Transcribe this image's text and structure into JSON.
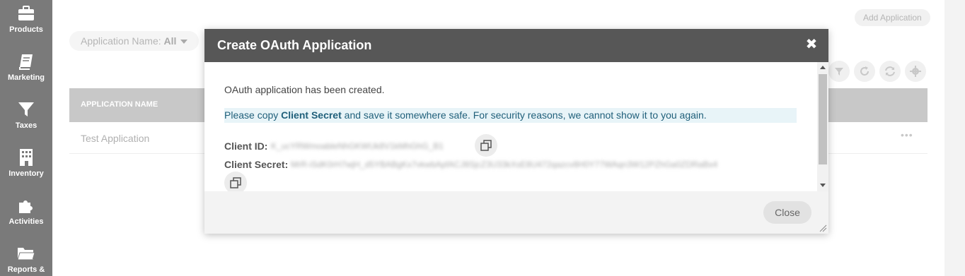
{
  "sidebar": {
    "items": [
      {
        "label": "Products",
        "icon": "briefcase-icon"
      },
      {
        "label": "Marketing",
        "icon": "book-icon"
      },
      {
        "label": "Taxes",
        "icon": "funnel-icon"
      },
      {
        "label": "Inventory",
        "icon": "building-icon"
      },
      {
        "label": "Activities",
        "icon": "puzzle-icon"
      },
      {
        "label": "Reports &",
        "icon": "folder-icon"
      }
    ]
  },
  "main": {
    "add_button": "Add Application",
    "filter": {
      "label": "Application Name:",
      "value": "All"
    },
    "table": {
      "header": "APPLICATION NAME",
      "rows": [
        {
          "name": "Test Application",
          "actions": "•••"
        }
      ]
    },
    "toolbar_icons": [
      "filter-icon",
      "refresh-icon",
      "sync-icon",
      "settings-icon"
    ]
  },
  "modal": {
    "title": "Create OAuth Application",
    "close_symbol": "✖",
    "message": "OAuth application has been created.",
    "notice_pre": "Please copy ",
    "notice_bold": "Client Secret",
    "notice_post": " and save it somewhere safe. For security reasons, we cannot show it to you again.",
    "client_id_label": "Client ID:",
    "client_id_value": "K_ucYRWmoableNhGKWUk8V1kMhGhG_B1",
    "client_secret_label": "Client Secret:",
    "client_secret_value": "MrR-iSdK0rH7wjH_d5YBABgKx7vkwbApfACJ8SjcZ3U33kXsE8U472qazcv8H0Y77WAqn3W12PZhGa0ZDRaBx4",
    "close_button": "Close"
  }
}
